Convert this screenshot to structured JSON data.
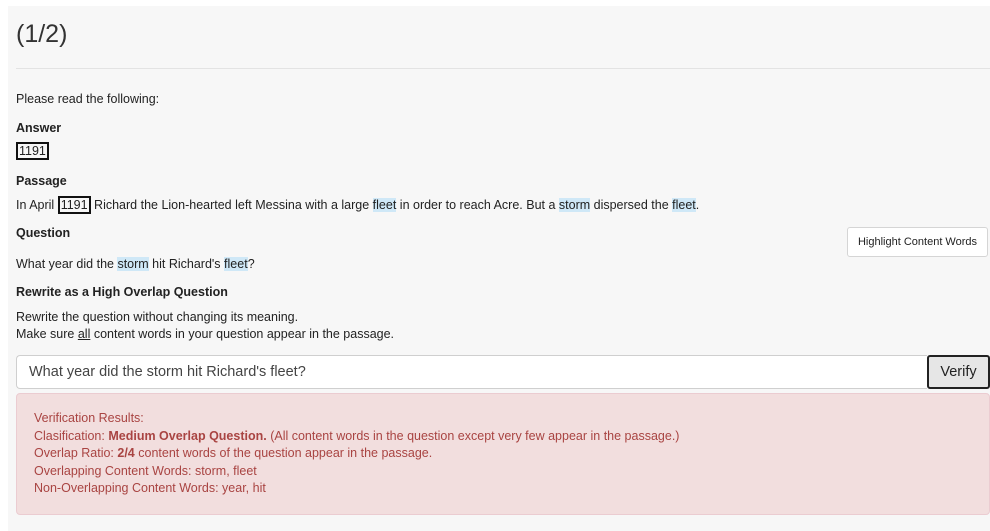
{
  "header": {
    "step_counter": "(1/2)"
  },
  "instructions": {
    "intro": "Please read the following:"
  },
  "answer": {
    "heading": "Answer",
    "value": "1191"
  },
  "passage": {
    "heading": "Passage",
    "segments": [
      {
        "text": "In April ",
        "style": "plain"
      },
      {
        "text": "1191",
        "style": "boxed"
      },
      {
        "text": " Richard the Lion-hearted left Messina with a large ",
        "style": "plain"
      },
      {
        "text": "fleet",
        "style": "highlight"
      },
      {
        "text": " in order to reach Acre. But a ",
        "style": "plain"
      },
      {
        "text": "storm",
        "style": "highlight"
      },
      {
        "text": " dispersed the ",
        "style": "plain"
      },
      {
        "text": "fleet",
        "style": "highlight"
      },
      {
        "text": ".",
        "style": "plain"
      }
    ]
  },
  "question": {
    "heading": "Question",
    "segments": [
      {
        "text": "What year did the ",
        "style": "plain"
      },
      {
        "text": "storm",
        "style": "highlight"
      },
      {
        "text": " hit Richard's ",
        "style": "plain"
      },
      {
        "text": "fleet",
        "style": "highlight"
      },
      {
        "text": "?",
        "style": "plain"
      }
    ],
    "highlight_button_label": "Highlight Content Words"
  },
  "rewrite": {
    "heading": "Rewrite as a High Overlap Question",
    "instruction_line1": "Rewrite the question without changing its meaning.",
    "instruction_line2": {
      "segments": [
        {
          "text": "Make sure ",
          "style": "plain"
        },
        {
          "text": "all",
          "style": "underline"
        },
        {
          "text": " content words in your question appear in the passage.",
          "style": "plain"
        }
      ]
    },
    "input_value": "What year did the storm hit Richard's fleet?",
    "verify_label": "Verify"
  },
  "verification": {
    "title": "Verification Results:",
    "classification": {
      "label": "Clasification: ",
      "value": "Medium Overlap Question.",
      "detail": " (All content words in the question except very few appear in the passage.)"
    },
    "overlap_ratio": {
      "label": "Overlap Ratio: ",
      "value": "2/4",
      "detail": " content words of the question appear in the passage."
    },
    "overlapping": "Overlapping Content Words: storm, fleet",
    "non_overlapping": "Non-Overlapping Content Words: year, hit"
  },
  "colors": {
    "highlight": "#cfe8f7",
    "alert_background": "#f2dede",
    "alert_text": "#a94442",
    "panel_background": "#f7f7f7"
  }
}
